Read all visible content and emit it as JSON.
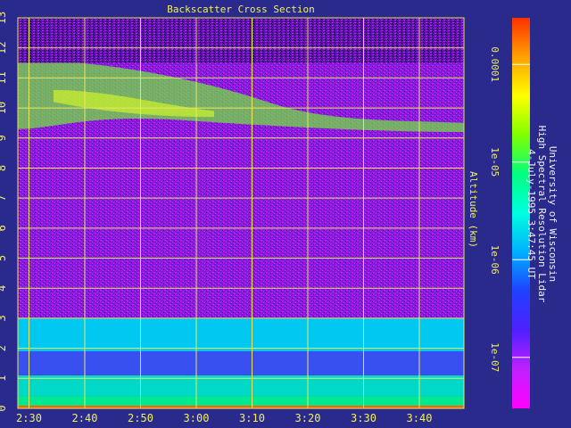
{
  "chart_data": {
    "type": "heatmap",
    "title": "Backscatter Cross Section",
    "ylabel": "Altitude (km)",
    "x_ticks": [
      "2:30",
      "2:40",
      "2:50",
      "3:00",
      "3:10",
      "3:20",
      "3:30",
      "3:40"
    ],
    "y_ticks": [
      "0",
      "1",
      "2",
      "3",
      "4",
      "5",
      "6",
      "7",
      "8",
      "9",
      "10",
      "11",
      "12",
      "13"
    ],
    "ylim": [
      0,
      13
    ],
    "time_range": [
      "2:28",
      "3:48"
    ],
    "grid": true,
    "colorbar": {
      "scale": "log",
      "range": [
        3e-08,
        0.0003
      ],
      "ticks": [
        "0.0001",
        "1e-05",
        "1e-06",
        "1e-07"
      ],
      "colors": [
        "#ff00ff",
        "#c020ff",
        "#5020ff",
        "#2040ff",
        "#00b0ff",
        "#00ffe0",
        "#00ff80",
        "#80ff00",
        "#ffff00",
        "#ffa000",
        "#ff3000"
      ]
    },
    "layers": [
      {
        "from_km": 0.0,
        "to_km": 0.4,
        "level": "high",
        "color": "#00e890"
      },
      {
        "from_km": 0.4,
        "to_km": 1.1,
        "level": "moderate",
        "color": "#00d8c8"
      },
      {
        "from_km": 1.1,
        "to_km": 1.9,
        "level": "low",
        "color": "#3850f0"
      },
      {
        "from_km": 1.9,
        "to_km": 3.0,
        "level": "moderate",
        "color": "#00c8f0"
      },
      {
        "from_km": 3.0,
        "to_km": 9.0,
        "level": "noise",
        "color": "#a020e0"
      },
      {
        "from_km": 9.0,
        "to_km": 11.5,
        "level": "cloud",
        "color": "#70e040"
      },
      {
        "from_km": 11.5,
        "to_km": 13.0,
        "level": "noise",
        "color": "#8010c0"
      }
    ]
  },
  "annotation": {
    "line1": "University of Wisconsin",
    "line2": "High Spectral Resolution Lidar",
    "line3": "4-July-1995  3:47:45 UT"
  }
}
